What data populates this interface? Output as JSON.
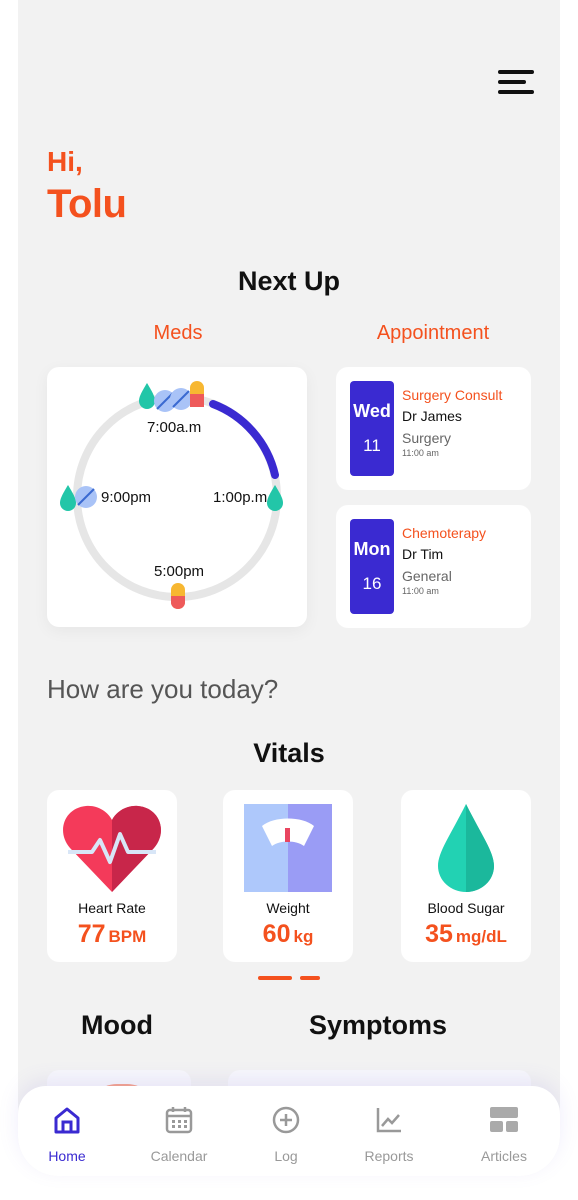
{
  "user": {
    "greeting": "Hi,",
    "name": "Tolu"
  },
  "next_up": {
    "title": "Next Up",
    "meds_label": "Meds",
    "appointment_label": "Appointment",
    "med_times": [
      "7:00a.m",
      "1:00p.m",
      "5:00pm",
      "9:00pm"
    ],
    "appointments": [
      {
        "dow": "Wed",
        "day": "11",
        "title": "Surgery Consult",
        "doctor": "Dr James",
        "dept": "Surgery",
        "time": "11:00 am"
      },
      {
        "dow": "Mon",
        "day": "16",
        "title": "Chemoterapy",
        "doctor": "Dr Tim",
        "dept": "General",
        "time": "11:00 am"
      }
    ]
  },
  "how_are_you": "How are you today?",
  "vitals": {
    "title": "Vitals",
    "items": [
      {
        "label": "Heart Rate",
        "value": "77",
        "unit": "BPM",
        "icon": "heart-rate-icon"
      },
      {
        "label": "Weight",
        "value": "60",
        "unit": "kg",
        "icon": "scale-icon"
      },
      {
        "label": "Blood Sugar",
        "value": "35",
        "unit": "mg/dL",
        "icon": "blood-drop-icon"
      }
    ]
  },
  "mood_title": "Mood",
  "symptoms_title": "Symptoms",
  "tabs": [
    {
      "label": "Home",
      "icon": "home-icon",
      "active": true
    },
    {
      "label": "Calendar",
      "icon": "calendar-icon",
      "active": false
    },
    {
      "label": "Log",
      "icon": "plus-circle-icon",
      "active": false
    },
    {
      "label": "Reports",
      "icon": "chart-icon",
      "active": false
    },
    {
      "label": "Articles",
      "icon": "grid-icon",
      "active": false
    }
  ],
  "colors": {
    "accent": "#f4511e",
    "primary": "#3a2ad1",
    "teal": "#22c6a8",
    "background": "#f2f2f2"
  }
}
